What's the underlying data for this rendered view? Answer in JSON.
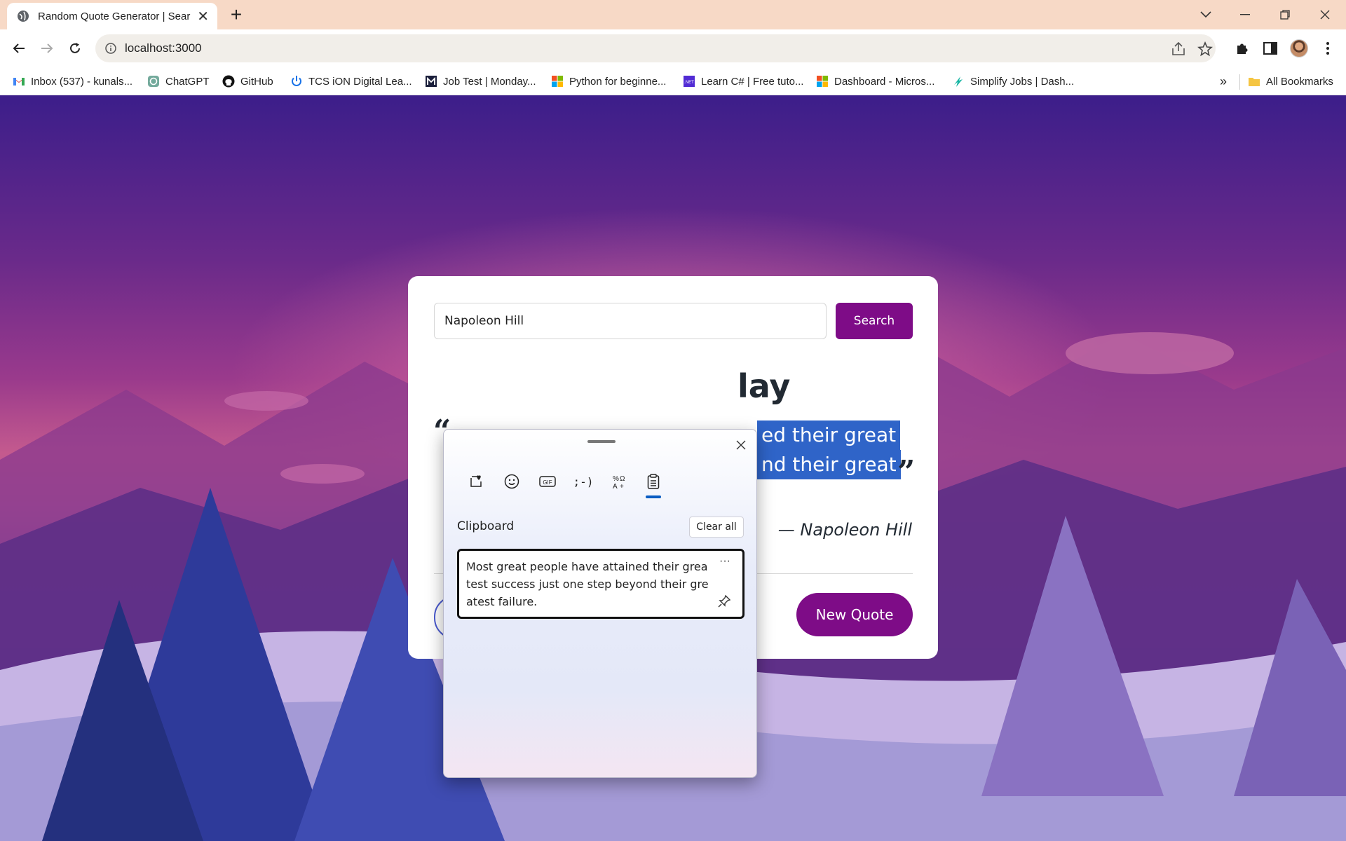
{
  "browser": {
    "tab_title": "Random Quote Generator | Sear",
    "url": "localhost:3000",
    "bookmarks": [
      {
        "label": "Inbox (537) - kunals...",
        "icon": "gmail-icon"
      },
      {
        "label": "ChatGPT",
        "icon": "chatgpt-icon"
      },
      {
        "label": "GitHub",
        "icon": "github-icon"
      },
      {
        "label": "TCS iON Digital Lea...",
        "icon": "power-icon"
      },
      {
        "label": "Job Test | Monday...",
        "icon": "m-icon"
      },
      {
        "label": "Python for beginne...",
        "icon": "microsoft-icon"
      },
      {
        "label": "Learn C# | Free tuto...",
        "icon": "dotnet-icon"
      },
      {
        "label": "Dashboard - Micros...",
        "icon": "microsoft-icon"
      },
      {
        "label": "Simplify Jobs | Dash...",
        "icon": "simplify-icon"
      }
    ],
    "overflow": "»",
    "all_bookmarks": "All Bookmarks"
  },
  "app": {
    "search_value": "Napoleon Hill",
    "search_button": "Search",
    "heading_fragment": "lay",
    "quote_line1_fragment": "ed their great",
    "quote_line2_fragment": "nd their great",
    "author": "— Napoleon Hill",
    "new_quote_button": "New Quote",
    "open_quote_mark": "“",
    "close_quote_mark": "”"
  },
  "clipboard_panel": {
    "title": "Clipboard",
    "clear_all": "Clear all",
    "item_text": "Most great people have attained their greatest success just one step beyond their greatest failure.",
    "more": "···",
    "tabs": [
      "favorites-icon",
      "emoji-icon",
      "gif-icon",
      "kaomoji-icon",
      "symbols-icon",
      "clipboard-icon"
    ]
  },
  "colors": {
    "accent_purple": "#7e0c87",
    "selection_blue": "#2f64c8",
    "panel_tab_active": "#0a5cc2"
  }
}
